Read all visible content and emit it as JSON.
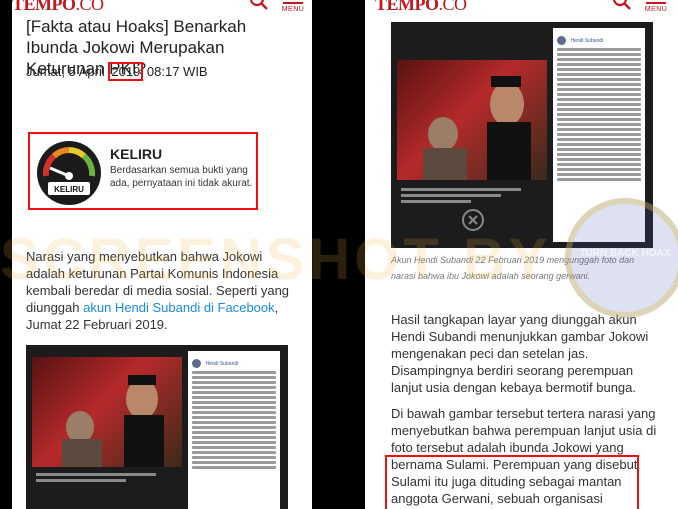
{
  "left": {
    "logo_main": "TEMPO",
    "logo_suffix": ".CO",
    "menu_label": "MENU",
    "headline": "[Fakta atau Hoaks] Benarkah Ibunda Jokowi Merupakan Keturunan PKI?",
    "date_prefix": "Jumat, 5 April ",
    "date_year": "2019",
    "date_time": " 08:17 WIB",
    "verdict_title": "KELIRU",
    "gauge_label": "KELIRU",
    "verdict_desc": "Berdasarkan semua bukti yang ada, pernyataan ini tidak akurat.",
    "para_text": "Narasi yang menyebutkan bahwa Jokowi adalah keturunan Partai Komunis Indonesia kembali beredar di media sosial. Seperti yang diunggah ",
    "para_link": "akun Hendi Subandi di Facebook",
    "para_after": ", Jumat 22 Februari 2019.",
    "fb_poster": "Hendi Subandi"
  },
  "right": {
    "logo_main": "TEMPO",
    "logo_suffix": ".CO",
    "menu_label": "MENU",
    "fb_poster": "Hendi Subandi",
    "caption": "Akun Hendi Subandi 22 Februari 2019 mengunggah foto dan narasi bahwa ibu Jokowi adalah seorang gerwani.",
    "para1": "Hasil tangkapan layar yang diunggah akun Hendi Subandi menunjukkan gambar Jokowi mengenakan peci dan setelan jas. Disampingnya berdiri seorang perempuan lanjut usia dengan kebaya bermotif bunga.",
    "para2": "Di bawah gambar tersebut tertera narasi yang menyebutkan bahwa perempuan lanjut usia di foto tersebut adalah ibunda Jokowi yang bernama Sulami. Perempuan yang disebut Sulami itu juga dituding sebagai mantan anggota Gerwani, sebuah organisasi"
  },
  "watermark": "SCREENSHOT BY",
  "seal_text": "TURN BACK HOAX",
  "colors": {
    "brand_red": "#c4161c",
    "annotation_red": "#ee1111",
    "link_blue": "#1a8be0"
  }
}
